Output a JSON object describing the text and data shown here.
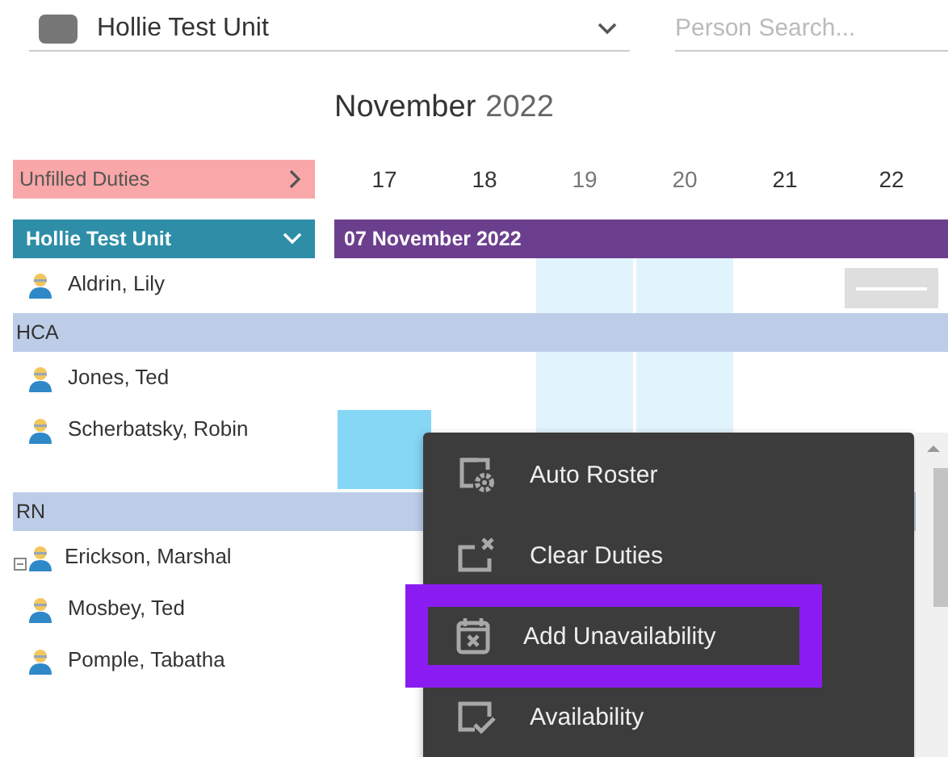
{
  "unit_select": {
    "value": "Hollie Test Unit"
  },
  "search": {
    "placeholder": "Person Search..."
  },
  "month": {
    "name": "November",
    "year": "2022"
  },
  "unfilled": {
    "label": "Unfilled Duties"
  },
  "days": [
    {
      "label": "17",
      "weekend": false
    },
    {
      "label": "18",
      "weekend": false
    },
    {
      "label": "19",
      "weekend": true
    },
    {
      "label": "20",
      "weekend": true
    },
    {
      "label": "21",
      "weekend": false
    },
    {
      "label": "22",
      "weekend": false
    }
  ],
  "unit_header": {
    "label": "Hollie Test Unit",
    "expanded": true
  },
  "week_banner": "07 November 2022",
  "rows": [
    {
      "kind": "person",
      "name": "Aldrin, Lily",
      "note": false,
      "cells": [
        {
          "kind": "empty"
        },
        {
          "kind": "empty"
        },
        {
          "kind": "empty"
        },
        {
          "kind": "empty"
        },
        {
          "kind": "empty"
        },
        {
          "kind": "pending"
        }
      ]
    },
    {
      "kind": "group",
      "name": "HCA"
    },
    {
      "kind": "person",
      "name": "Jones, Ted",
      "note": false,
      "cells": [
        {
          "kind": "empty"
        },
        {
          "kind": "empty"
        },
        {
          "kind": "empty"
        },
        {
          "kind": "empty"
        },
        {
          "kind": "empty"
        },
        {
          "kind": "empty"
        }
      ]
    },
    {
      "kind": "person",
      "name": "Scherbatsky, Robin",
      "note": false,
      "cells": [
        {
          "kind": "duty"
        },
        {
          "kind": "empty"
        },
        {
          "kind": "empty"
        },
        {
          "kind": "empty"
        },
        {
          "kind": "empty"
        },
        {
          "kind": "empty"
        }
      ]
    },
    {
      "kind": "group",
      "name": "RN"
    },
    {
      "kind": "person",
      "name": "Erickson, Marshal",
      "note": true,
      "cells": [
        {
          "kind": "empty"
        },
        {
          "kind": "empty"
        },
        {
          "kind": "empty"
        },
        {
          "kind": "empty"
        },
        {
          "kind": "empty"
        },
        {
          "kind": "empty"
        }
      ]
    },
    {
      "kind": "person",
      "name": "Mosbey, Ted",
      "note": false,
      "cells": [
        {
          "kind": "empty"
        },
        {
          "kind": "empty"
        },
        {
          "kind": "empty"
        },
        {
          "kind": "empty"
        },
        {
          "kind": "empty"
        },
        {
          "kind": "empty"
        }
      ]
    },
    {
      "kind": "person",
      "name": "Pomple, Tabatha",
      "note": false,
      "cells": [
        {
          "kind": "empty"
        },
        {
          "kind": "empty"
        },
        {
          "kind": "empty"
        },
        {
          "kind": "empty"
        },
        {
          "kind": "empty"
        },
        {
          "kind": "empty"
        }
      ]
    }
  ],
  "context_menu": [
    {
      "kind": "auto-roster",
      "label": "Auto Roster",
      "selected": false
    },
    {
      "kind": "clear",
      "label": "Clear Duties",
      "selected": false
    },
    {
      "kind": "unavailability",
      "label": "Add Unavailability",
      "selected": true
    },
    {
      "kind": "availability",
      "label": "Availability",
      "selected": false
    }
  ]
}
